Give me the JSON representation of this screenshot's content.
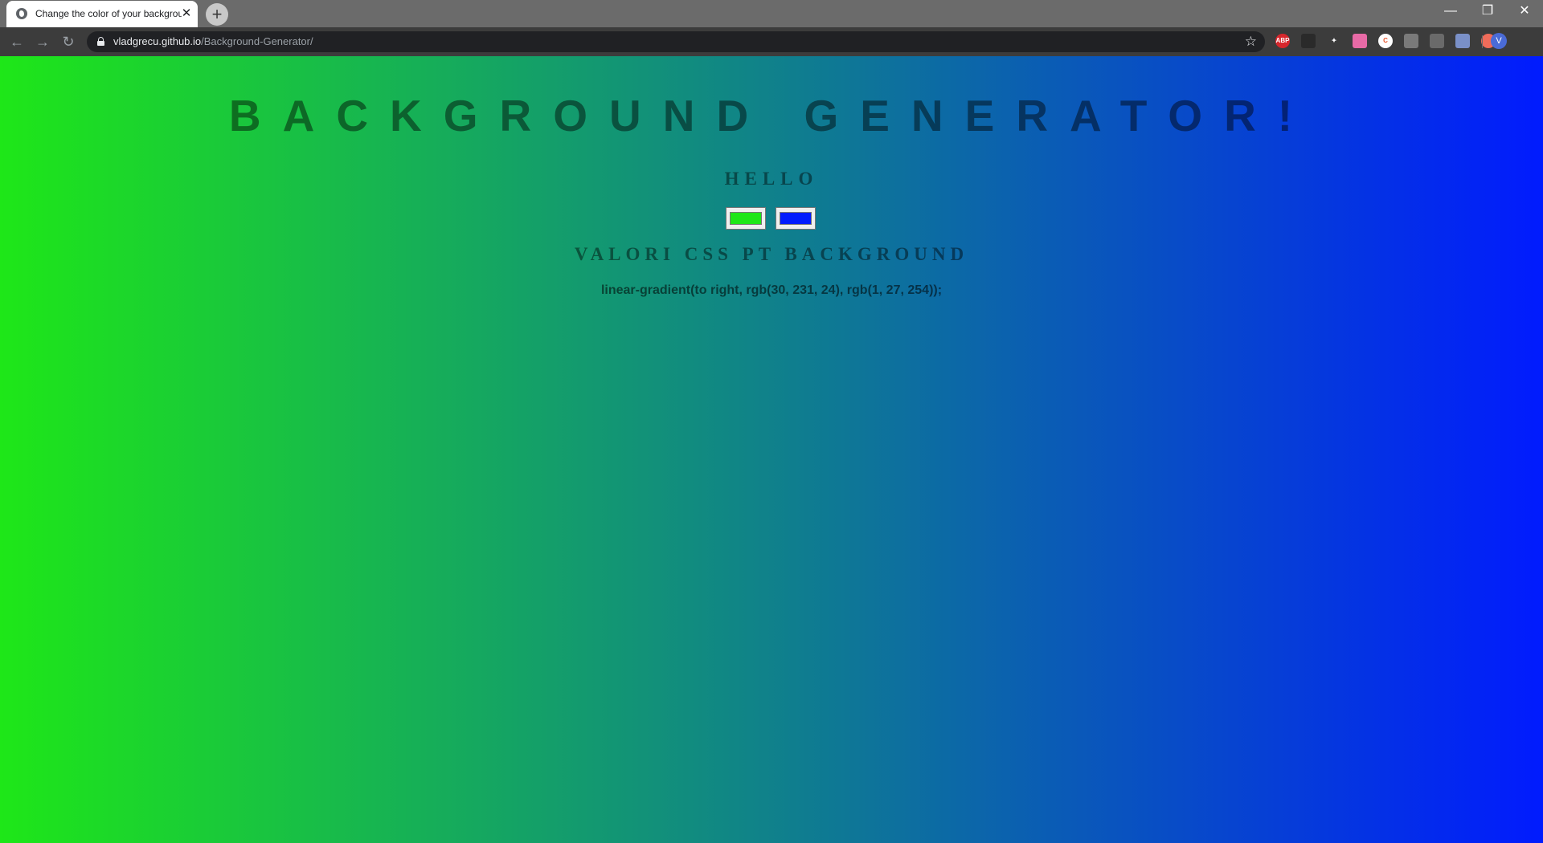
{
  "browser": {
    "tab": {
      "title": "Change the color of your background"
    },
    "new_tab_label": "+",
    "window_controls": {
      "minimize": "—",
      "restore": "❐",
      "close": "✕"
    },
    "nav": {
      "back": "←",
      "forward": "→",
      "reload": "↻"
    },
    "address": {
      "host": "vladgrecu.github.io",
      "path": "/Background-Generator/"
    },
    "bookmark_icon": "☆",
    "extensions": [
      {
        "name": "adblock-plus",
        "label": "ABP",
        "color": "#d7262c"
      },
      {
        "name": "acrobat",
        "label": "",
        "color": "#2a2a2a"
      },
      {
        "name": "pinwheel",
        "label": "✦",
        "color": "#3c3c3c"
      },
      {
        "name": "pink-app",
        "label": "",
        "color": "#e86aa6"
      },
      {
        "name": "colorzilla",
        "label": "C",
        "color": "#ffffff"
      },
      {
        "name": "grey-ext-1",
        "label": "",
        "color": "#7a7a7a"
      },
      {
        "name": "grey-ext-2",
        "label": "",
        "color": "#6a6a6a"
      },
      {
        "name": "blue-ext",
        "label": "",
        "color": "#7a90c8"
      },
      {
        "name": "red-ext",
        "label": "",
        "color": "#f06c5a"
      }
    ],
    "profile_initial": "V"
  },
  "page": {
    "heading": "BACKGROUND GENERATOR!",
    "hello": "HELLO",
    "color_inputs": [
      {
        "label": "color-1",
        "value": "#1ee718"
      },
      {
        "label": "color-2",
        "value": "#011bfe"
      }
    ],
    "subheading": "VALORI CSS PT BACKGROUND",
    "css_value": "linear-gradient(to right, rgb(30, 231, 24), rgb(1, 27, 254));"
  }
}
